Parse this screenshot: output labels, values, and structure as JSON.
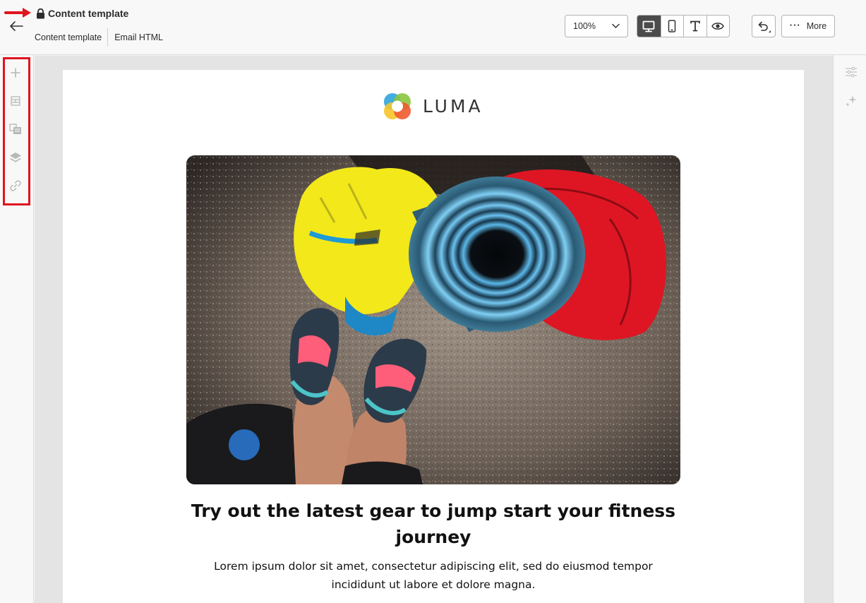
{
  "header": {
    "title": "Content template",
    "subnav": [
      "Content template",
      "Email HTML"
    ],
    "zoom": "100%",
    "view_modes": [
      {
        "name": "desktop",
        "icon": "desktop-icon",
        "active": true
      },
      {
        "name": "mobile",
        "icon": "mobile-icon",
        "active": false
      },
      {
        "name": "text",
        "icon": "text-icon",
        "active": false
      },
      {
        "name": "preview",
        "icon": "eye-icon",
        "active": false
      }
    ],
    "undo_icon": "undo-icon",
    "more_label": "More"
  },
  "left_rail": {
    "highlight_color": "#e0141e",
    "items": [
      {
        "icon": "add-icon"
      },
      {
        "icon": "structure-icon"
      },
      {
        "icon": "fragments-icon"
      },
      {
        "icon": "layers-icon"
      },
      {
        "icon": "link-icon"
      }
    ]
  },
  "right_rail": {
    "items": [
      {
        "icon": "settings-sliders-icon"
      },
      {
        "icon": "sparkle-icon"
      }
    ]
  },
  "email": {
    "logo_text": "LUMA",
    "headline": "Try out the latest gear to jump start your fitness journey",
    "body": "Lorem ipsum dolor sit amet, consectetur adipiscing elit, sed do eiusmod tempor incididunt ut labore et dolore magna."
  },
  "colors": {
    "accent_red": "#e0141e",
    "active_toggle": "#4b4b4b"
  }
}
